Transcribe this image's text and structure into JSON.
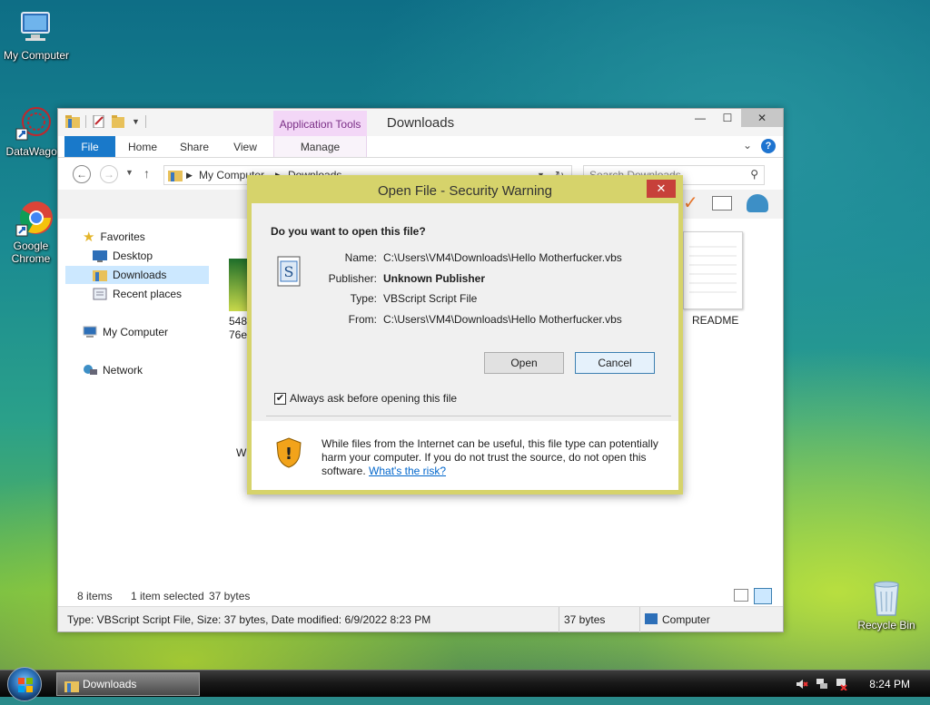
{
  "desktop": {
    "icons": [
      {
        "label": "My Computer"
      },
      {
        "label": "DataWagon"
      },
      {
        "label": "Google Chrome"
      },
      {
        "label": "Recycle Bin"
      }
    ]
  },
  "explorer": {
    "title": "Downloads",
    "context_tab": "Application Tools",
    "tabs": [
      "File",
      "Home",
      "Share",
      "View",
      "Manage"
    ],
    "breadcrumb": [
      "My Computer",
      "Downloads"
    ],
    "search_placeholder": "Search Downloads",
    "nav": {
      "favorites": "Favorites",
      "desktop": "Desktop",
      "downloads": "Downloads",
      "recent": "Recent places",
      "computer": "My Computer",
      "network": "Network"
    },
    "files": {
      "partial1": "548b",
      "partial2": "76e",
      "partial3": "Wi",
      "readme": "README"
    },
    "status": {
      "items": "8 items",
      "selected": "1 item selected",
      "size": "37 bytes"
    },
    "details": {
      "info": "Type: VBScript Script File, Size: 37 bytes, Date modified: 6/9/2022 8:23 PM",
      "size": "37 bytes",
      "location": "Computer"
    }
  },
  "dialog": {
    "title": "Open File - Security Warning",
    "question": "Do you want to open this file?",
    "name_label": "Name:",
    "name_value": "C:\\Users\\VM4\\Downloads\\Hello Motherfucker.vbs",
    "publisher_label": "Publisher:",
    "publisher_value": "Unknown Publisher",
    "type_label": "Type:",
    "type_value": "VBScript Script File",
    "from_label": "From:",
    "from_value": "C:\\Users\\VM4\\Downloads\\Hello Motherfucker.vbs",
    "open_button": "Open",
    "cancel_button": "Cancel",
    "checkbox_label": "Always ask before opening this file",
    "checkbox_checked": true,
    "warning_text": "While files from the Internet can be useful, this file type can potentially harm your computer. If you do not trust the source, do not open this software.",
    "risk_link": "What's the risk?"
  },
  "taskbar": {
    "task_label": "Downloads",
    "clock": "8:24 PM"
  },
  "colors": {
    "dialog_frame": "#d6d36b",
    "file_tab": "#1979ca",
    "close_red": "#c7403a",
    "selection": "#cce8ff"
  }
}
